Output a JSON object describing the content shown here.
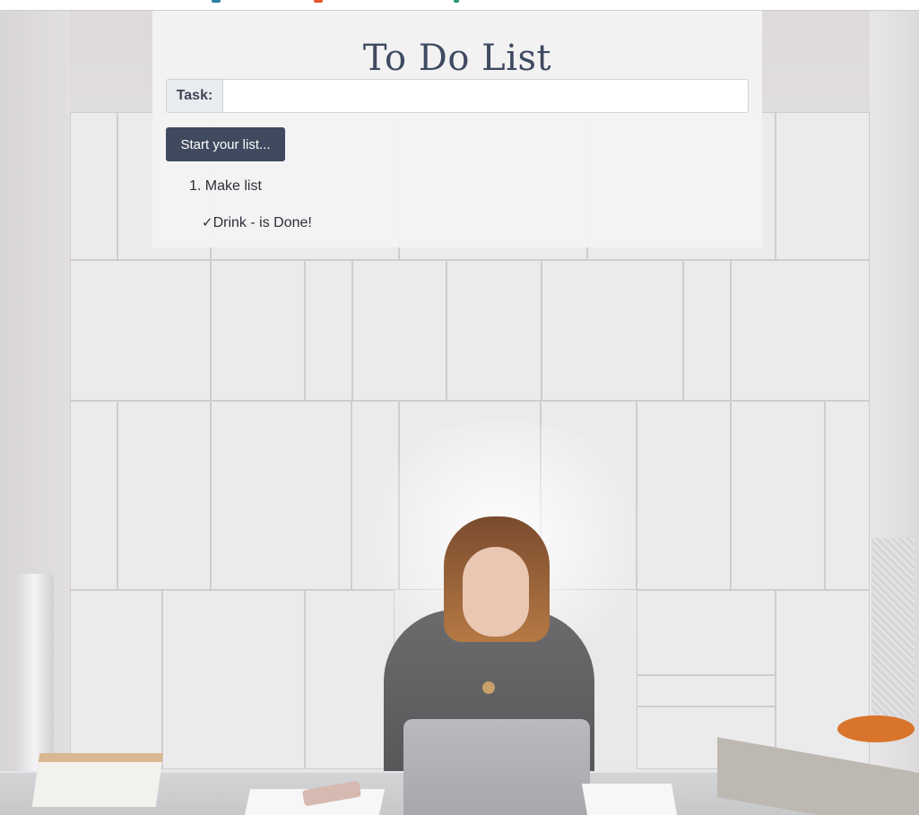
{
  "page": {
    "title": "To Do List"
  },
  "form": {
    "task_label": "Task:",
    "task_value": "",
    "start_button": "Start your list..."
  },
  "list": {
    "items": [
      {
        "number": "1.",
        "text": "Make list"
      }
    ],
    "completed": [
      {
        "check": "✓",
        "text": "Drink - is Done!"
      }
    ]
  },
  "colors": {
    "accent": "#3f4a5f",
    "title": "#3e4a61",
    "panel": "#f4f3f3"
  }
}
